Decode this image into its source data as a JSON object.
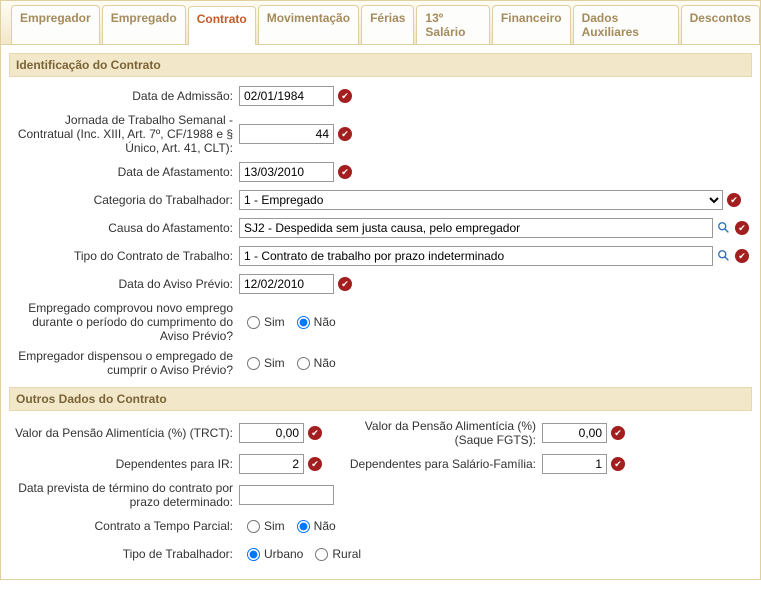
{
  "tabs": {
    "empregador": "Empregador",
    "empregado": "Empregado",
    "contrato": "Contrato",
    "movimentacao": "Movimentação",
    "ferias": "Férias",
    "salario13": "13º Salário",
    "financeiro": "Financeiro",
    "dados_aux": "Dados Auxiliares",
    "descontos": "Descontos"
  },
  "sections": {
    "identificacao": "Identificação do Contrato",
    "outros": "Outros Dados do Contrato"
  },
  "labels": {
    "data_admissao": "Data de Admissão:",
    "jornada": "Jornada de Trabalho Semanal - Contratual (Inc. XIII, Art. 7º, CF/1988 e § Único, Art. 41, CLT):",
    "data_afastamento": "Data de Afastamento:",
    "categoria": "Categoria do Trabalhador:",
    "causa_afastamento": "Causa do Afastamento:",
    "tipo_contrato": "Tipo do Contrato de Trabalho:",
    "data_aviso": "Data do Aviso Prévio:",
    "comprovou": "Empregado comprovou novo emprego durante o período do cumprimento do Aviso Prévio?",
    "dispensou": "Empregador dispensou o empregado de cumprir o Aviso Prévio?",
    "pensao_trct": "Valor da Pensão Alimentícia (%) (TRCT):",
    "pensao_fgts": "Valor da Pensão Alimentícia (%) (Saque FGTS):",
    "dep_ir": "Dependentes para IR:",
    "dep_sf": "Dependentes para Salário-Família:",
    "data_termino": "Data prevista de término do contrato por prazo determinado:",
    "tempo_parcial": "Contrato a Tempo Parcial:",
    "tipo_trabalhador": "Tipo de Trabalhador:"
  },
  "values": {
    "data_admissao": "02/01/1984",
    "jornada": "44",
    "data_afastamento": "13/03/2010",
    "categoria": "1 - Empregado",
    "causa_afastamento": "SJ2 - Despedida sem justa causa, pelo empregador",
    "tipo_contrato": "1 - Contrato de trabalho por prazo indeterminado",
    "data_aviso": "12/02/2010",
    "pensao_trct": "0,00",
    "pensao_fgts": "0,00",
    "dep_ir": "2",
    "dep_sf": "1",
    "data_termino": ""
  },
  "radio": {
    "sim": "Sim",
    "nao": "Não",
    "urbano": "Urbano",
    "rural": "Rural"
  }
}
